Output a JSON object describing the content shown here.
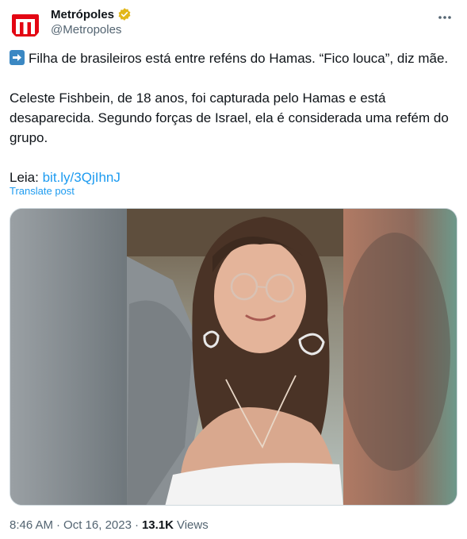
{
  "author": {
    "display_name": "Metrópoles",
    "handle": "@Metropoles",
    "avatar_letter": "M",
    "brand_color": "#e30613",
    "verified_color": "#e2b719"
  },
  "tweet": {
    "line1": "Filha de brasileiros está entre reféns do Hamas. “Fico louca”, diz mãe.",
    "line2": "Celeste Fishbein, de 18 anos, foi capturada pelo Hamas e está desaparecida. Segundo forças de Israel, ela é considerada uma refém do grupo.",
    "read_label": "Leia: ",
    "link_text": "bit.ly/3QjIhnJ",
    "translate_label": "Translate post"
  },
  "media": {
    "alt": "",
    "icon": "photo"
  },
  "footer": {
    "time": "8:46 AM",
    "date": "Oct 16, 2023",
    "views_count": "13.1K",
    "views_label": "Views"
  },
  "icons": {
    "more": "more-horizontal-icon",
    "verified": "verified-badge-icon",
    "arrow": "right-arrow-emoji"
  },
  "colors": {
    "link": "#1d9bf0",
    "secondary_text": "#536471",
    "primary_text": "#0f1419"
  }
}
